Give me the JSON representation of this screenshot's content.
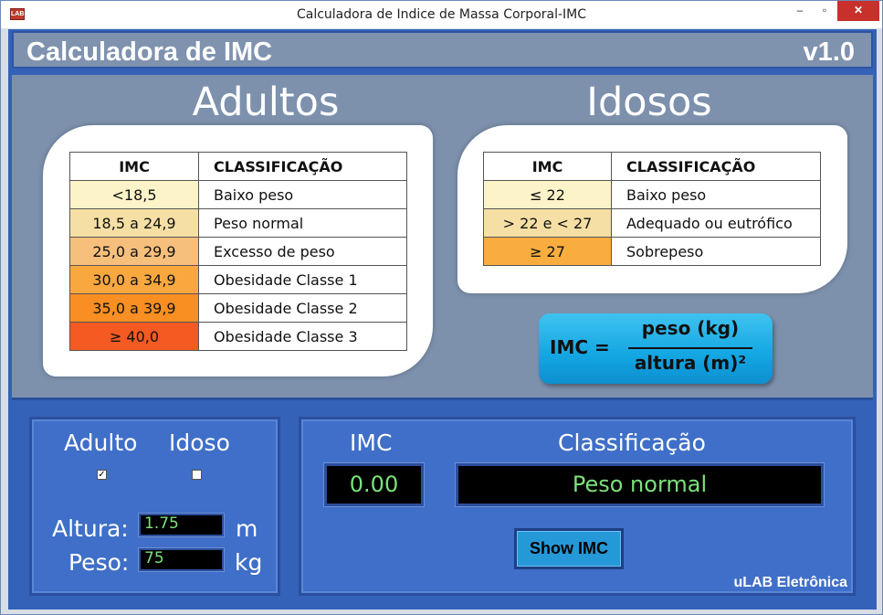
{
  "window": {
    "title": "Calculadora de Indice de Massa Corporal-IMC",
    "icon": "app-icon",
    "controls": {
      "minimize": "–",
      "maximize": "▫",
      "close": "✕"
    }
  },
  "header": {
    "title": "Calculadora de IMC",
    "version": "v1.0"
  },
  "adultos": {
    "title": "Adultos",
    "col_imc": "IMC",
    "col_class": "CLASSIFICAÇÃO",
    "rows": [
      {
        "imc": "<18,5",
        "label": "Baixo peso",
        "color": "#fdf3c8"
      },
      {
        "imc": "18,5 a 24,9",
        "label": "Peso normal",
        "color": "#f6dfa4"
      },
      {
        "imc": "25,0 a 29,9",
        "label": "Excesso de peso",
        "color": "#f7bf7c"
      },
      {
        "imc": "30,0 a 34,9",
        "label": "Obesidade Classe 1",
        "color": "#f9a83f"
      },
      {
        "imc": "35,0 a 39,9",
        "label": "Obesidade Classe 2",
        "color": "#f98f22"
      },
      {
        "imc": "≥ 40,0",
        "label": "Obesidade Classe 3",
        "color": "#f45a22"
      }
    ]
  },
  "idosos": {
    "title": "Idosos",
    "col_imc": "IMC",
    "col_class": "CLASSIFICAÇÃO",
    "rows": [
      {
        "imc": "≤ 22",
        "label": "Baixo peso",
        "color": "#fdf3c8"
      },
      {
        "imc": "> 22 e < 27",
        "label": "Adequado ou eutrófico",
        "color": "#f6dfa4"
      },
      {
        "imc": "≥ 27",
        "label": "Sobrepeso",
        "color": "#f9ad3f"
      }
    ]
  },
  "formula": {
    "lhs": "IMC =",
    "numerator": "peso (kg)",
    "denominator": "altura (m)²"
  },
  "input_panel": {
    "adulto_label": "Adulto",
    "idoso_label": "Idoso",
    "adulto_checked": true,
    "idoso_checked": false,
    "altura_label": "Altura:",
    "altura_value": "1.75",
    "altura_unit": "m",
    "peso_label": "Peso:",
    "peso_value": "75",
    "peso_unit": "kg"
  },
  "result_panel": {
    "imc_label": "IMC",
    "imc_value": "0.00",
    "class_label": "Classificação",
    "class_value": "Peso normal",
    "button_label": "Show IMC",
    "credit": "uLAB Eletrônica"
  },
  "colors": {
    "frame": "#3462b8",
    "panel": "#3f6fc8",
    "info_bg": "#7d91ad",
    "display_text": "#7be27b",
    "button": "#2598d8"
  }
}
